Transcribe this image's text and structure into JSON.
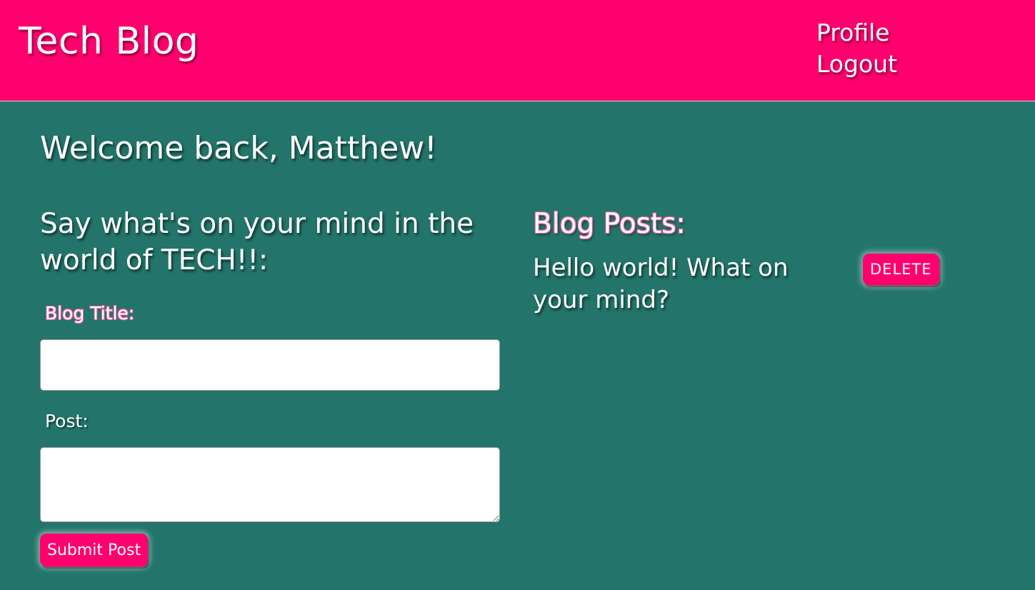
{
  "header": {
    "site_title": "Tech Blog",
    "nav": {
      "profile_label": "Profile",
      "logout_label": "Logout"
    }
  },
  "dashboard": {
    "welcome": "Welcome back, Matthew!",
    "form": {
      "heading": "Say what's on your mind in the world of TECH!!:",
      "title_label": "Blog Title:",
      "title_value": "",
      "post_label": "Post:",
      "post_value": "",
      "submit_label": "Submit Post"
    },
    "posts": {
      "heading": "Blog Posts:",
      "items": [
        {
          "title": "Hello world! What on your mind?",
          "delete_label": "DELETE"
        }
      ]
    }
  },
  "colors": {
    "header_bg": "#ff006e",
    "page_bg": "#23746a",
    "button_bg": "#ff006e",
    "text": "#ffffff"
  }
}
